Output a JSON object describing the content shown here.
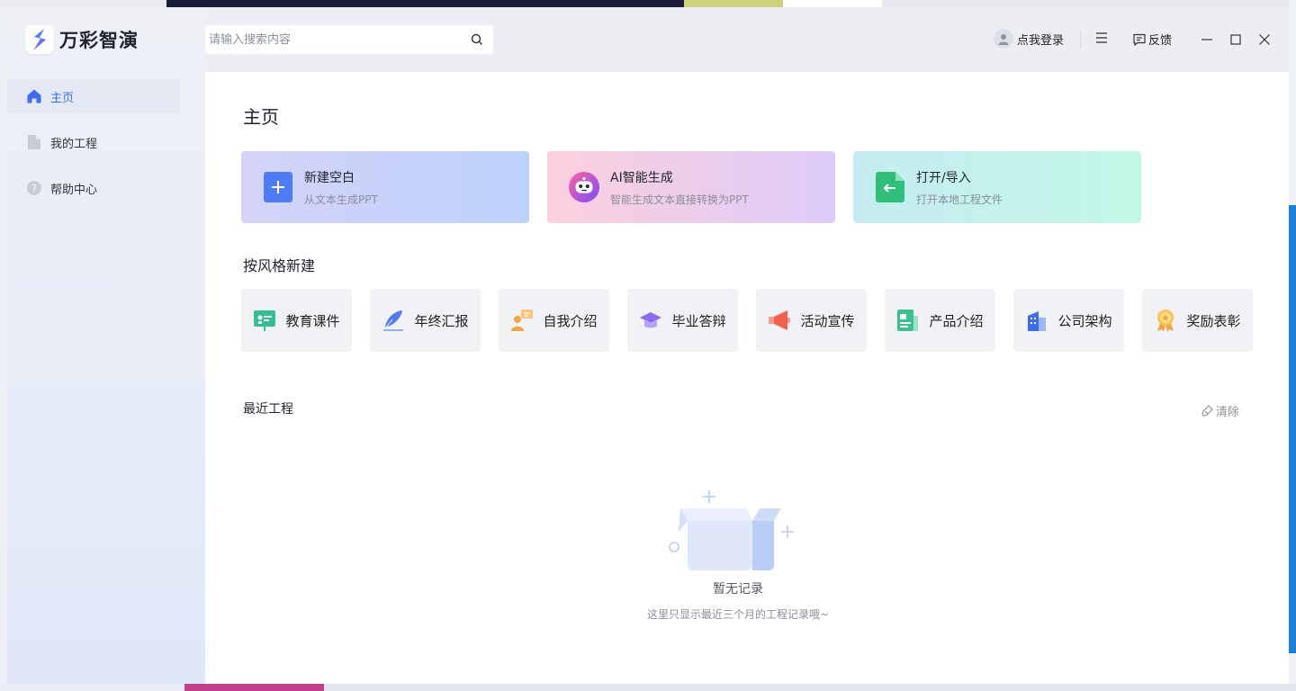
{
  "app": {
    "name": "万彩智演"
  },
  "sidebar": {
    "items": [
      {
        "label": "主页",
        "icon": "home-icon",
        "active": true
      },
      {
        "label": "我的工程",
        "icon": "document-icon",
        "active": false
      },
      {
        "label": "帮助中心",
        "icon": "help-icon",
        "active": false
      }
    ]
  },
  "header": {
    "search": {
      "placeholder": "请输入搜索内容",
      "value": ""
    },
    "login_label": "点我登录",
    "feedback_label": "反馈"
  },
  "main": {
    "title": "主页",
    "cards": [
      {
        "title": "新建空白",
        "subtitle": "从文本生成PPT",
        "icon": "plus-icon"
      },
      {
        "title": "AI智能生成",
        "subtitle": "智能生成文本直接转换为PPT",
        "icon": "robot-icon"
      },
      {
        "title": "打开/导入",
        "subtitle": "打开本地工程文件",
        "icon": "import-icon"
      }
    ],
    "styles_title": "按风格新建",
    "styles": [
      {
        "label": "教育课件",
        "icon": "presentation-board-icon"
      },
      {
        "label": "年终汇报",
        "icon": "feather-pen-icon"
      },
      {
        "label": "自我介绍",
        "icon": "person-chat-icon"
      },
      {
        "label": "毕业答辩",
        "icon": "graduation-cap-icon"
      },
      {
        "label": "活动宣传",
        "icon": "megaphone-icon"
      },
      {
        "label": "产品介绍",
        "icon": "product-doc-icon"
      },
      {
        "label": "公司架构",
        "icon": "building-icon"
      },
      {
        "label": "奖励表彰",
        "icon": "award-medal-icon"
      }
    ],
    "recent_title": "最近工程",
    "clear_label": "清除",
    "empty_title": "暂无记录",
    "empty_subtitle": "这里只显示最近三个月的工程记录哦~"
  },
  "colors": {
    "accent": "#3d6cf0",
    "sidebar_bg": "#eef0f6",
    "main_bg": "#ffffff"
  }
}
